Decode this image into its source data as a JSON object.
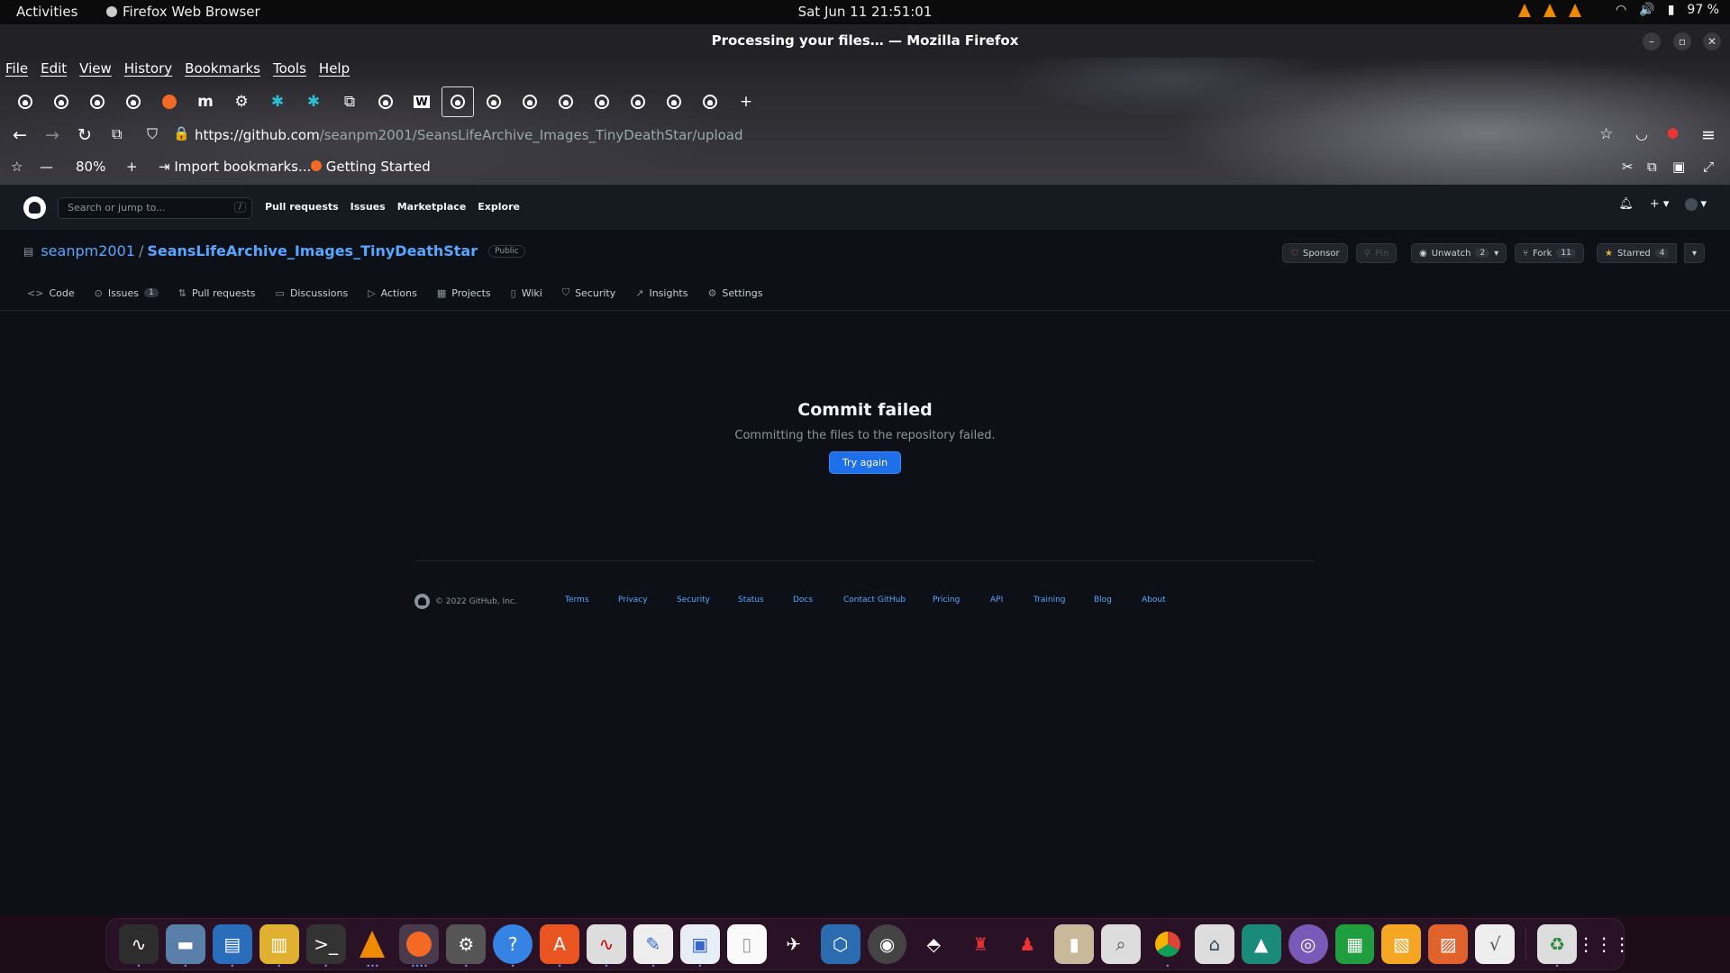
{
  "system": {
    "activities": "Activities",
    "app_name": "Firefox Web Browser",
    "clock": "Sat Jun 11  21:51:01",
    "battery": "97 %"
  },
  "browser": {
    "window_title": "Processing your files… — Mozilla Firefox",
    "menu": [
      "File",
      "Edit",
      "View",
      "History",
      "Bookmarks",
      "Tools",
      "Help"
    ],
    "url_host": "https://github.com",
    "url_path": "/seanpm2001/SeansLifeArchive_Images_TinyDeathStar/upload",
    "zoom": "80%",
    "bookmarks": [
      "Import bookmarks...",
      "Getting Started"
    ]
  },
  "github": {
    "search_placeholder": "Search or jump to...",
    "search_key": "/",
    "nav": [
      "Pull requests",
      "Issues",
      "Marketplace",
      "Explore"
    ],
    "owner": "seanpm2001",
    "separator": "/",
    "repo": "SeansLifeArchive_Images_TinyDeathStar",
    "visibility": "Public",
    "buttons": {
      "sponsor": "Sponsor",
      "pin": "Pin",
      "unwatch": "Unwatch",
      "unwatch_count": "2",
      "fork": "Fork",
      "fork_count": "11",
      "starred": "Starred",
      "star_count": "4"
    },
    "tabs": [
      "Code",
      "Issues",
      "Pull requests",
      "Discussions",
      "Actions",
      "Projects",
      "Wiki",
      "Security",
      "Insights",
      "Settings"
    ],
    "issues_count": "1",
    "blankslate": {
      "title": "Commit failed",
      "message": "Committing the files to the repository failed.",
      "button": "Try again"
    },
    "footer": {
      "copyright": "© 2022 GitHub, Inc.",
      "links": [
        "Terms",
        "Privacy",
        "Security",
        "Status",
        "Docs",
        "Contact GitHub",
        "Pricing",
        "API",
        "Training",
        "Blog",
        "About"
      ]
    }
  },
  "colors": {
    "primary_button": "#1f6feb",
    "link": "#58a6ff",
    "background": "#0d1117"
  }
}
